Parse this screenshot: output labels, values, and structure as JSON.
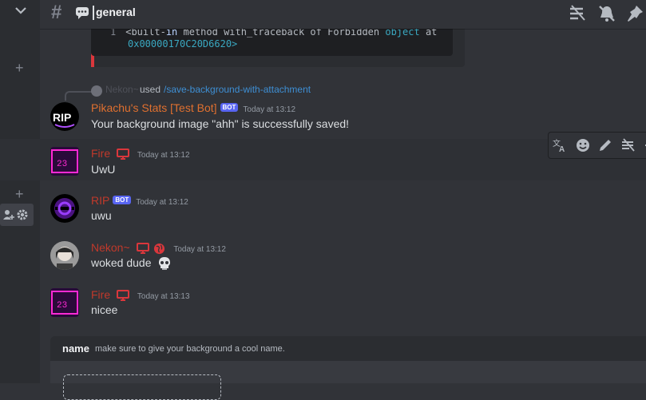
{
  "channel": {
    "name": "general"
  },
  "code": {
    "line_number": "1",
    "line1_pre": "<built-",
    "line1_in": "in",
    "line1_mid": " method with_traceback of Forbidden ",
    "line1_obj": "object",
    "line1_post": " at",
    "line2": "0x00000170C20D6620>"
  },
  "reply": {
    "user": "Nekon~",
    "used": "used",
    "command": "/save-background-with-attachment"
  },
  "messages": [
    {
      "author": "Pikachu's Stats [Test Bot]",
      "author_color": "#e0702f",
      "badge": "BOT",
      "timestamp": "Today at 13:12",
      "content": "Your background image \"ahh\" is successfully saved!"
    },
    {
      "author": "Fire",
      "author_color": "#c0392b",
      "timestamp": "Today at 13:12",
      "content": "UwU"
    },
    {
      "author": "RIP",
      "author_color": "#c0392b",
      "badge": "BOT",
      "timestamp": "Today at 13:12",
      "content": "uwu"
    },
    {
      "author": "Nekon~",
      "author_color": "#c0392b",
      "timestamp": "Today at 13:12",
      "content": "woked dude"
    },
    {
      "author": "Fire",
      "author_color": "#c0392b",
      "timestamp": "Today at 13:13",
      "content": "nicee"
    }
  ],
  "command_option": {
    "name": "name",
    "description": "make sure to give your background a cool name."
  },
  "colors": {
    "accent": "#5865f2",
    "danger": "#da373c",
    "link": "#3e8fd4"
  }
}
